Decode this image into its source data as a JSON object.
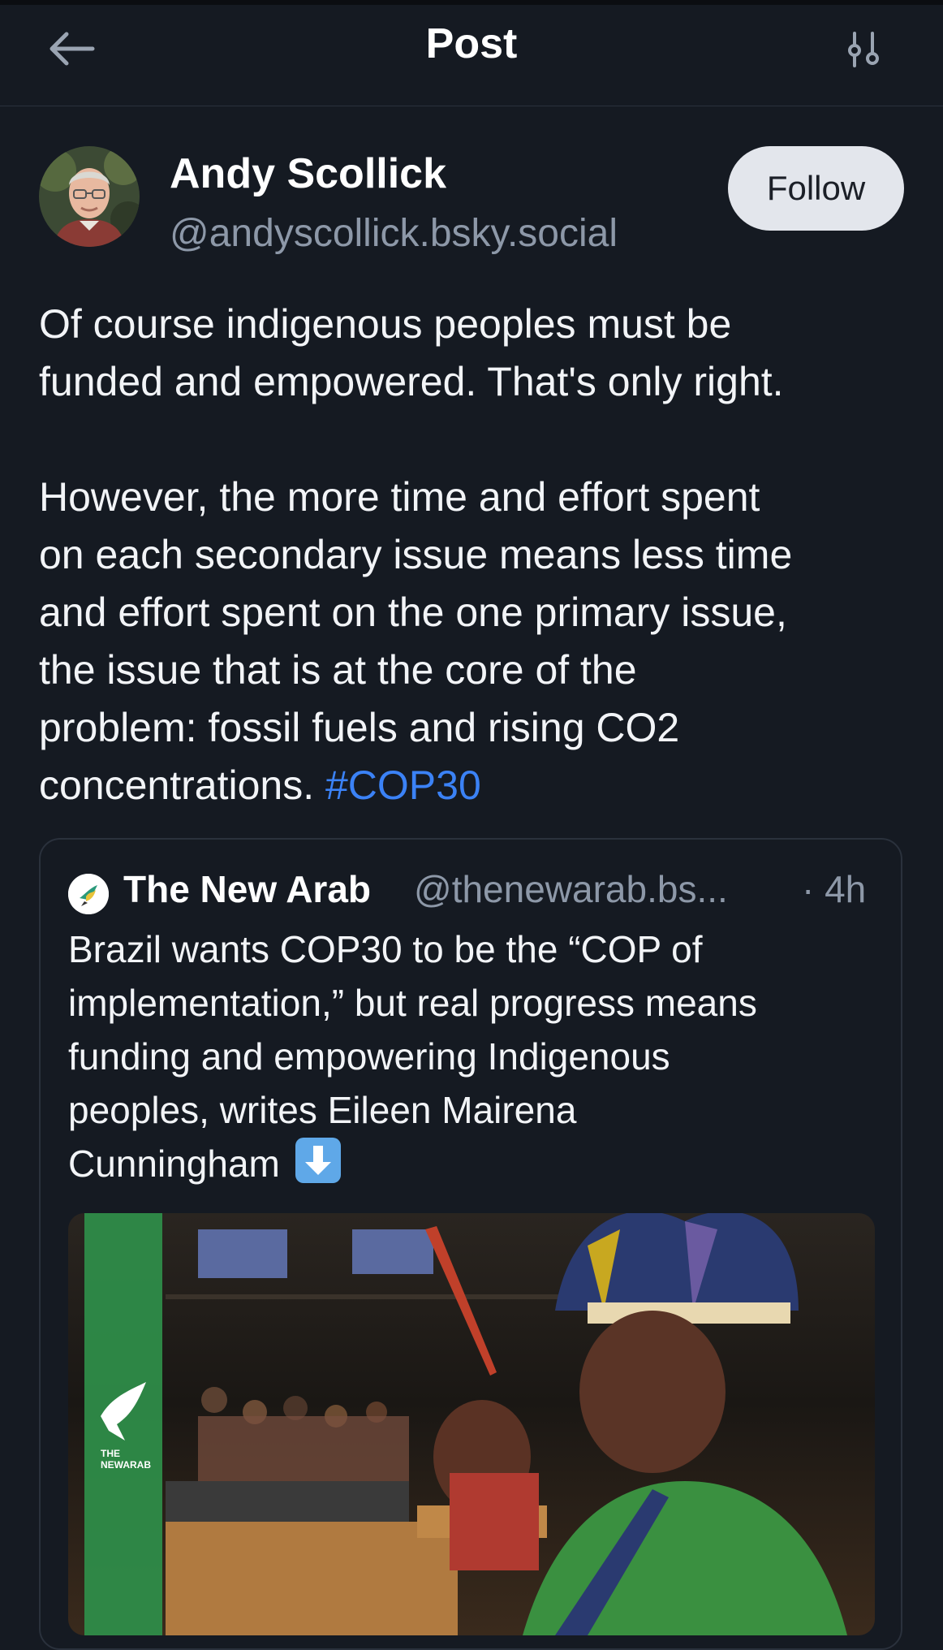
{
  "header": {
    "title": "Post",
    "back_icon": "arrow-left-icon",
    "filter_icon": "sliders-icon"
  },
  "author": {
    "name": "Andy Scollick",
    "handle": "@andyscollick.bsky.social",
    "follow_label": "Follow"
  },
  "post": {
    "lines_p1": [
      "Of course indigenous peoples must be",
      "funded and empowered. That's only right."
    ],
    "lines_p2": [
      "However, the more time and effort spent",
      "on each secondary issue means less time",
      "and effort spent on the one primary issue,",
      "the issue that is at the core of the",
      "problem: fossil fuels and rising CO2"
    ],
    "last_line_text": "concentrations.",
    "hashtag": "#COP30"
  },
  "quote": {
    "author": "The New Arab",
    "handle": "@thenewarab.bs...",
    "time": "· 4h",
    "lines": [
      "Brazil wants COP30 to be the “COP of",
      "implementation,” but real progress means",
      "funding and empowering Indigenous",
      "peoples, writes Eileen Mairena"
    ],
    "last_line": "Cunningham",
    "emoji": "down-arrow-emoji",
    "image_logo": "THE NEWARAB"
  },
  "colors": {
    "background": "#151a22",
    "text": "#f2f4f7",
    "muted": "#8d98a8",
    "link": "#3b82f6",
    "border": "#2a313c",
    "follow_bg": "#e3e6ec"
  }
}
